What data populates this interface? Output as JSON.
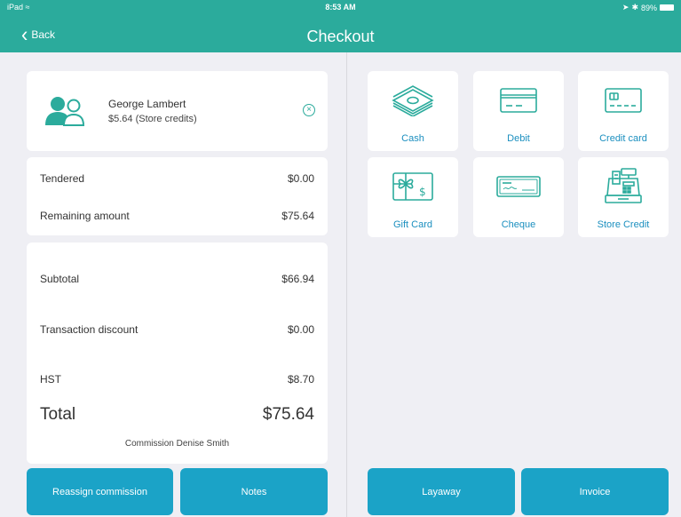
{
  "status_bar": {
    "device": "iPad",
    "time": "8:53 AM",
    "battery": "89%"
  },
  "nav": {
    "back_label": "Back",
    "title": "Checkout"
  },
  "customer": {
    "name": "George Lambert",
    "credit": "$5.64  (Store credits)"
  },
  "tender": [
    {
      "label": "Tendered",
      "value": "$0.00"
    },
    {
      "label": "Remaining amount",
      "value": "$75.64"
    }
  ],
  "totals": {
    "subtotal_label": "Subtotal",
    "subtotal_value": "$66.94",
    "discount_label": "Transaction discount",
    "discount_value": "$0.00",
    "tax_label": "HST",
    "tax_value": "$8.70",
    "total_label": "Total",
    "total_value": "$75.64",
    "commission": "Commission Denise Smith"
  },
  "payment_methods": [
    {
      "label": "Cash",
      "icon": "cash-icon"
    },
    {
      "label": "Debit",
      "icon": "debit-card-icon"
    },
    {
      "label": "Credit card",
      "icon": "credit-card-icon"
    },
    {
      "label": "Gift Card",
      "icon": "gift-card-icon"
    },
    {
      "label": "Cheque",
      "icon": "cheque-icon"
    },
    {
      "label": "Store Credit",
      "icon": "cash-register-icon"
    }
  ],
  "actions": {
    "reassign": "Reassign commission",
    "notes": "Notes",
    "layaway": "Layaway",
    "invoice": "Invoice"
  },
  "colors": {
    "header": "#2bab9c",
    "button": "#1ba3c7",
    "accent": "#2bab9c",
    "link": "#1b8fbf"
  }
}
